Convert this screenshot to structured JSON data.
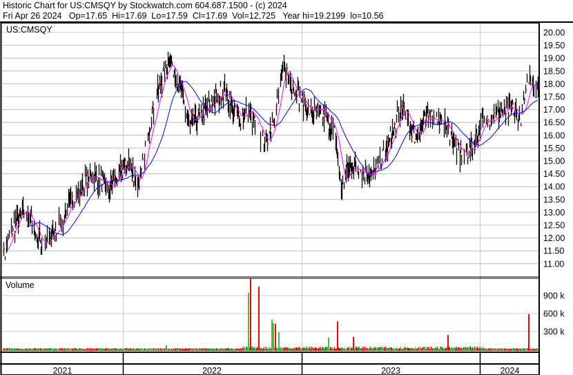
{
  "header": {
    "title": "Historic Chart for US:CMSQY by Stockwatch.com 604.687.1500 - (c) 2024",
    "summary": "Fri Apr 26 2024   Op=17.65  Hi=17.69  Lo=17.59  Cl=17.69  Vol=12,725   Year hi=19.2199  lo=10.56"
  },
  "chart_data": {
    "type": "line",
    "title": "US:CMSQY",
    "symbol": "US:CMSQY",
    "price_axis": {
      "ticks": [
        "20.00",
        "19.50",
        "19.00",
        "18.50",
        "18.00",
        "17.50",
        "17.00",
        "16.50",
        "16.00",
        "15.50",
        "15.00",
        "14.50",
        "14.00",
        "13.50",
        "13.00",
        "12.50",
        "12.00",
        "11.50",
        "11.00"
      ],
      "ylim": [
        10.5,
        20.35
      ]
    },
    "volume_axis": {
      "label": "Volume",
      "ticks": [
        "900 k",
        "600 k",
        "300 k"
      ],
      "tick_values": [
        900000,
        600000,
        300000
      ]
    },
    "x_labels": [
      "2021",
      "2022",
      "2023",
      "2024"
    ],
    "x_note": "x values in decimal years",
    "price_keypoints": [
      [
        2021.32,
        11.05
      ],
      [
        2021.38,
        12.4
      ],
      [
        2021.45,
        13.1
      ],
      [
        2021.55,
        11.7
      ],
      [
        2021.61,
        12.1
      ],
      [
        2021.7,
        13.3
      ],
      [
        2021.82,
        14.5
      ],
      [
        2021.92,
        13.9
      ],
      [
        2022.03,
        14.95
      ],
      [
        2022.09,
        14.0
      ],
      [
        2022.14,
        16.2
      ],
      [
        2022.22,
        18.3
      ],
      [
        2022.26,
        19.0
      ],
      [
        2022.32,
        17.8
      ],
      [
        2022.37,
        16.3
      ],
      [
        2022.47,
        17.0
      ],
      [
        2022.57,
        17.8
      ],
      [
        2022.64,
        16.6
      ],
      [
        2022.7,
        17.0
      ],
      [
        2022.8,
        15.6
      ],
      [
        2022.86,
        17.2
      ],
      [
        2022.9,
        18.7
      ],
      [
        2022.96,
        17.8
      ],
      [
        2023.03,
        17.0
      ],
      [
        2023.13,
        16.8
      ],
      [
        2023.19,
        16.0
      ],
      [
        2023.22,
        13.9
      ],
      [
        2023.27,
        14.8
      ],
      [
        2023.33,
        14.7
      ],
      [
        2023.4,
        14.4
      ],
      [
        2023.48,
        15.5
      ],
      [
        2023.56,
        17.1
      ],
      [
        2023.64,
        15.9
      ],
      [
        2023.71,
        16.8
      ],
      [
        2023.81,
        16.4
      ],
      [
        2023.89,
        15.2
      ],
      [
        2023.95,
        15.5
      ],
      [
        2024.02,
        16.55
      ],
      [
        2024.09,
        16.8
      ],
      [
        2024.17,
        17.0
      ],
      [
        2024.23,
        16.7
      ],
      [
        2024.28,
        18.3
      ],
      [
        2024.32,
        17.69
      ]
    ],
    "volume_spikes": [
      [
        2022.24,
        70000
      ],
      [
        2022.7,
        950000
      ],
      [
        2022.71,
        1180000
      ],
      [
        2022.76,
        1050000
      ],
      [
        2022.83,
        500000
      ],
      [
        2022.84,
        440000
      ],
      [
        2022.85,
        430000
      ],
      [
        2022.87,
        290000
      ],
      [
        2023.15,
        200000
      ],
      [
        2023.2,
        470000
      ],
      [
        2023.29,
        210000
      ],
      [
        2023.82,
        240000
      ],
      [
        2024.27,
        590000
      ]
    ],
    "series": [
      {
        "name": "Daily price bars",
        "color": "#000000",
        "close_marker": "#ff0000"
      },
      {
        "name": "Short moving average",
        "color": "#ff00ff"
      },
      {
        "name": "Long moving average",
        "color": "#0000ff"
      },
      {
        "name": "Volume up",
        "color": "#44bb44"
      },
      {
        "name": "Volume down",
        "color": "#ff0000"
      }
    ]
  }
}
